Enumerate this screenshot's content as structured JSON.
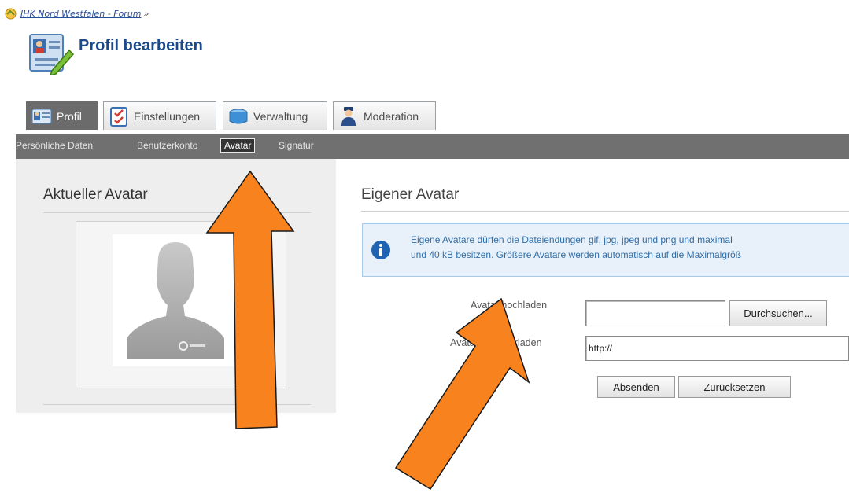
{
  "breadcrumb": {
    "link": "IHK Nord Westfalen - Forum",
    "separator": "»"
  },
  "page": {
    "title": "Profil bearbeiten"
  },
  "tabs": [
    {
      "label": "Profil",
      "icon": "profile-card-icon",
      "active": true
    },
    {
      "label": "Einstellungen",
      "icon": "checklist-icon",
      "active": false
    },
    {
      "label": "Verwaltung",
      "icon": "storage-box-icon",
      "active": false
    },
    {
      "label": "Moderation",
      "icon": "moderator-icon",
      "active": false
    }
  ],
  "subnav": [
    {
      "label": "Persönliche Daten",
      "active": false
    },
    {
      "label": "Benutzerkonto",
      "active": false
    },
    {
      "label": "Avatar",
      "active": true
    },
    {
      "label": "Signatur",
      "active": false
    }
  ],
  "current_avatar": {
    "title": "Aktueller Avatar"
  },
  "own_avatar": {
    "title": "Eigener Avatar",
    "info_line1": "Eigene Avatare dürfen die Dateiendungen gif, jpg, jpeg und png und maximal",
    "info_line2": "und 40 kB besitzen. Größere Avatare werden automatisch auf die Maximalgröß",
    "upload_label": "Avatar hochladen",
    "upload_value": "",
    "browse_button": "Durchsuchen...",
    "download_label": "Avatar herunterladen",
    "download_value": "http://",
    "submit_button": "Absenden",
    "reset_button": "Zurücksetzen"
  },
  "colors": {
    "title_blue": "#1b4a8c",
    "subnav_bg": "#707070",
    "arrow": "#f7821e"
  }
}
